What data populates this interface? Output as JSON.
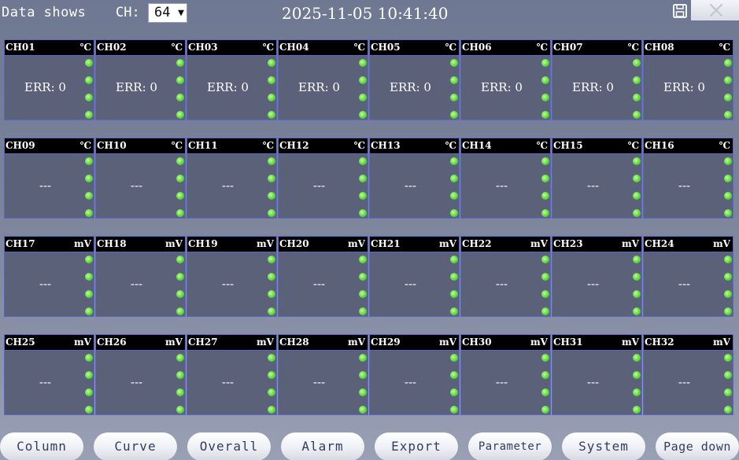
{
  "header": {
    "title": "Data shows",
    "ch_label": "CH:",
    "ch_value": "64",
    "datetime": "2025-11-05 10:41:40"
  },
  "icons": {
    "save": "save-icon",
    "close": "close-icon",
    "select_arrow": "chevron-down-icon",
    "status": "status-led-icon"
  },
  "colors": {
    "panel_border": "#5865c9",
    "panel_bg": "#5a6178",
    "led": "#6be04a"
  },
  "channels": [
    {
      "name": "CH01",
      "unit": "℃",
      "value": "ERR: 0"
    },
    {
      "name": "CH02",
      "unit": "℃",
      "value": "ERR: 0"
    },
    {
      "name": "CH03",
      "unit": "℃",
      "value": "ERR: 0"
    },
    {
      "name": "CH04",
      "unit": "℃",
      "value": "ERR: 0"
    },
    {
      "name": "CH05",
      "unit": "℃",
      "value": "ERR: 0"
    },
    {
      "name": "CH06",
      "unit": "℃",
      "value": "ERR: 0"
    },
    {
      "name": "CH07",
      "unit": "℃",
      "value": "ERR: 0"
    },
    {
      "name": "CH08",
      "unit": "℃",
      "value": "ERR: 0"
    },
    {
      "name": "CH09",
      "unit": "℃",
      "value": "---"
    },
    {
      "name": "CH10",
      "unit": "℃",
      "value": "---"
    },
    {
      "name": "CH11",
      "unit": "℃",
      "value": "---"
    },
    {
      "name": "CH12",
      "unit": "℃",
      "value": "---"
    },
    {
      "name": "CH13",
      "unit": "℃",
      "value": "---"
    },
    {
      "name": "CH14",
      "unit": "℃",
      "value": "---"
    },
    {
      "name": "CH15",
      "unit": "℃",
      "value": "---"
    },
    {
      "name": "CH16",
      "unit": "℃",
      "value": "---"
    },
    {
      "name": "CH17",
      "unit": "mV",
      "value": "---"
    },
    {
      "name": "CH18",
      "unit": "mV",
      "value": "---"
    },
    {
      "name": "CH19",
      "unit": "mV",
      "value": "---"
    },
    {
      "name": "CH20",
      "unit": "mV",
      "value": "---"
    },
    {
      "name": "CH21",
      "unit": "mV",
      "value": "---"
    },
    {
      "name": "CH22",
      "unit": "mV",
      "value": "---"
    },
    {
      "name": "CH23",
      "unit": "mV",
      "value": "---"
    },
    {
      "name": "CH24",
      "unit": "mV",
      "value": "---"
    },
    {
      "name": "CH25",
      "unit": "mV",
      "value": "---"
    },
    {
      "name": "CH26",
      "unit": "mV",
      "value": "---"
    },
    {
      "name": "CH27",
      "unit": "mV",
      "value": "---"
    },
    {
      "name": "CH28",
      "unit": "mV",
      "value": "---"
    },
    {
      "name": "CH29",
      "unit": "mV",
      "value": "---"
    },
    {
      "name": "CH30",
      "unit": "mV",
      "value": "---"
    },
    {
      "name": "CH31",
      "unit": "mV",
      "value": "---"
    },
    {
      "name": "CH32",
      "unit": "mV",
      "value": "---"
    }
  ],
  "toolbar": {
    "buttons": [
      {
        "label": "Column"
      },
      {
        "label": "Curve"
      },
      {
        "label": "Overall"
      },
      {
        "label": "Alarm"
      },
      {
        "label": "Export"
      },
      {
        "label": "Parameter"
      },
      {
        "label": "System"
      },
      {
        "label": "Page down"
      }
    ]
  }
}
